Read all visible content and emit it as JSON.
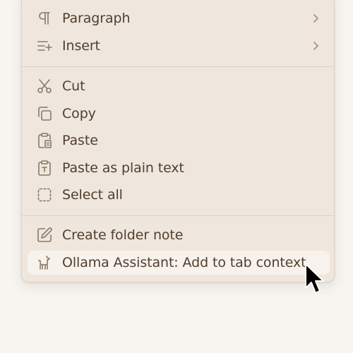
{
  "context_menu": {
    "items": [
      {
        "label": "Paragraph",
        "icon": "pilcrow-icon",
        "submenu": true
      },
      {
        "label": "Insert",
        "icon": "insert-list-icon",
        "submenu": true
      },
      {
        "label": "Cut",
        "icon": "scissors-icon"
      },
      {
        "label": "Copy",
        "icon": "copy-icon"
      },
      {
        "label": "Paste",
        "icon": "clipboard-paste-icon"
      },
      {
        "label": "Paste as plain text",
        "icon": "clipboard-type-icon"
      },
      {
        "label": "Select all",
        "icon": "dashed-square-icon"
      },
      {
        "label": "Create folder note",
        "icon": "edit-note-icon"
      },
      {
        "label": "Ollama Assistant: Add to tab context",
        "icon": "llama-icon",
        "highlighted": true
      }
    ]
  },
  "colors": {
    "menu_bg": "#efe6dd",
    "highlight_bg": "#f7f2ec",
    "text": "#4f3f30",
    "icon": "#8a7867",
    "separator": "#ddd1c4"
  }
}
